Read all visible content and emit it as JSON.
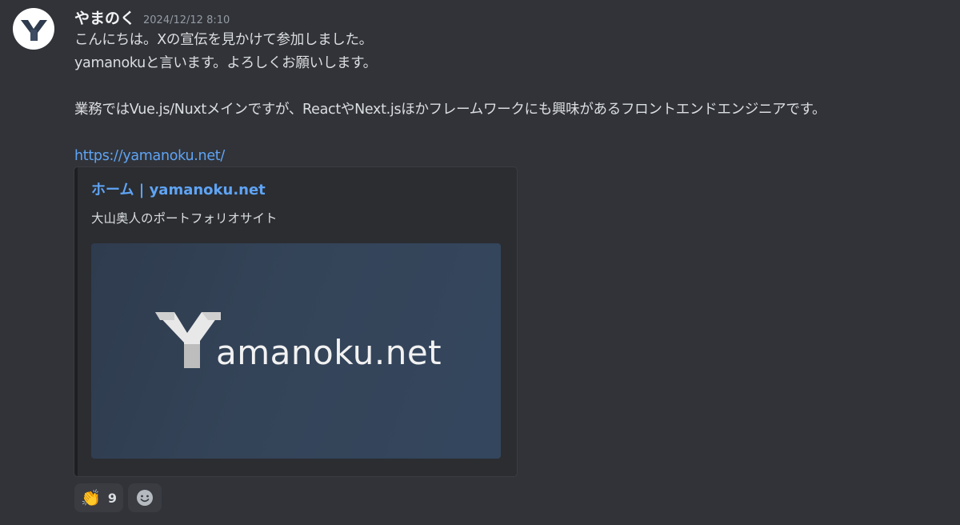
{
  "message": {
    "author": "やまのく",
    "timestamp": "2024/12/12 8:10",
    "lines": [
      "こんにちは。Xの宣伝を見かけて参加しました。",
      "yamanokuと言います。よろしくお願いします。",
      "業務ではVue.js/Nuxtメインですが、ReactやNext.jsほかフレームワークにも興味があるフロントエンドエンジニアです。"
    ],
    "link": "https://yamanoku.net/"
  },
  "embed": {
    "title": "ホーム | yamanoku.net",
    "description": "大山奥人のポートフォリオサイト",
    "image_text": "amanoku.net"
  },
  "reactions": [
    {
      "emoji": "👏",
      "count": "9"
    }
  ],
  "icons": {
    "avatar": "yamanoku-logo-icon",
    "add_reaction": "smile-face-icon"
  },
  "colors": {
    "background": "#313338",
    "link": "#5fa4f5",
    "embed_bg": "#2b2d31",
    "embed_image_bg": "#344458"
  }
}
